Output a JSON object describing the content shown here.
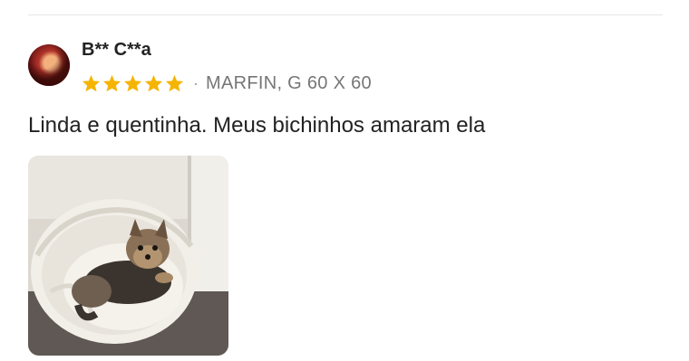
{
  "review": {
    "username": "B** C**a",
    "rating": 5,
    "rating_max": 5,
    "star_color": "#f5b400",
    "separator": "·",
    "variant": "MARFIN, G 60 X 60",
    "text": "Linda e quentinha. Meus bichinhos amaram ela"
  },
  "icons": {
    "star": "star-icon",
    "avatar": "user-avatar"
  }
}
